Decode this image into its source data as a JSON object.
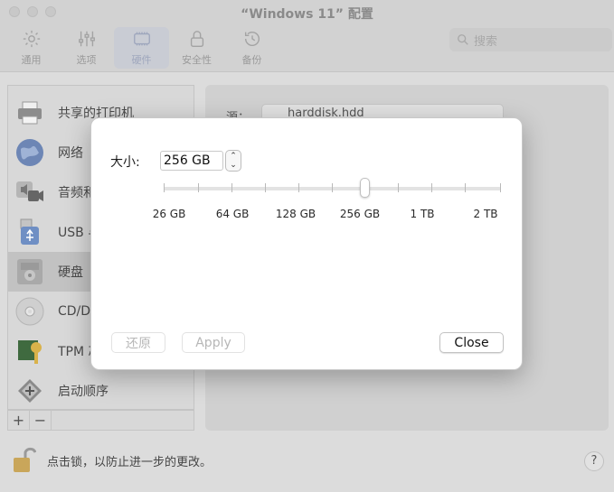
{
  "window": {
    "title": "“Windows 11” 配置"
  },
  "toolbar": {
    "items": [
      {
        "label": "通用",
        "icon": "gear-icon"
      },
      {
        "label": "选项",
        "icon": "sliders-icon"
      },
      {
        "label": "硬件",
        "icon": "hardware-icon"
      },
      {
        "label": "安全性",
        "icon": "lock-icon"
      },
      {
        "label": "备份",
        "icon": "history-icon"
      }
    ],
    "active": "硬件"
  },
  "search": {
    "placeholder": "搜索"
  },
  "sidebar": {
    "items": [
      {
        "label": "共享的打印机",
        "icon": "printer-icon"
      },
      {
        "label": "网络",
        "icon": "globe-icon"
      },
      {
        "label": "音频和",
        "icon": "audio-icon"
      },
      {
        "label": "USB 与",
        "icon": "usb-icon"
      },
      {
        "label": "硬盘",
        "icon": "hard-disk-icon"
      },
      {
        "label": "CD/DV",
        "icon": "cd-icon"
      },
      {
        "label": "TPM 芯",
        "icon": "tpm-icon"
      },
      {
        "label": "启动顺序",
        "icon": "boot-order-icon"
      }
    ],
    "selected": "硬盘",
    "add_label": "+",
    "remove_label": "−"
  },
  "panel": {
    "source_label": "源：",
    "source_value": "harddisk.hdd"
  },
  "footer": {
    "lock_text": "点击锁，以防止进一步的更改。",
    "help_label": "?"
  },
  "dialog": {
    "size_label": "大小:",
    "size_value": "256 GB",
    "stepper_up": "⌃",
    "stepper_down": "⌄",
    "slider": {
      "ticks": [
        "26 GB",
        "64 GB",
        "128 GB",
        "256 GB",
        "1 TB",
        "2 TB"
      ],
      "selected": "256 GB"
    },
    "revert_label": "还原",
    "apply_label": "Apply",
    "close_label": "Close"
  }
}
